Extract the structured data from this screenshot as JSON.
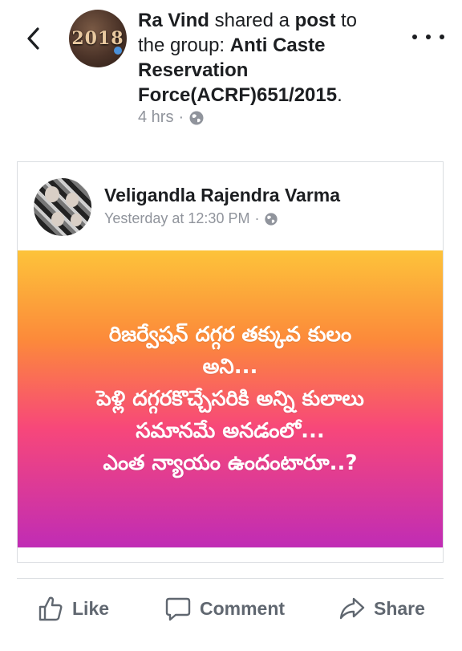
{
  "post": {
    "author": "Ra Vind",
    "shared_text": " shared a ",
    "post_word": "post",
    "to_text": " to the group: ",
    "group_name": "Anti Caste Reservation Force(ACRF)651/2015",
    "period": ".",
    "time": "4 hrs",
    "dot": "·",
    "avatar_text": "2018"
  },
  "shared": {
    "author": "Veligandla Rajendra Varma",
    "time": "Yesterday at 12:30 PM",
    "dot": "·",
    "lines": [
      "రిజర్వేషన్ దగ్గర తక్కువ కులం",
      "అని...",
      "పెళ్లి దగ్గరకొచ్చేసరికి అన్ని కులాలు",
      "సమానమే అనడంలో...",
      "ఎంత న్యాయం ఉందంటారూ..?"
    ]
  },
  "actions": {
    "like": "Like",
    "comment": "Comment",
    "share": "Share"
  },
  "colors": {
    "text": "#1c1e21",
    "meta": "#90949c",
    "action": "#606770",
    "gradient_top": "#fdc33a",
    "gradient_bottom": "#c02cb5"
  },
  "icons": {
    "back": "chevron-left-icon",
    "more": "more-horizontal-icon",
    "globe": "globe-icon",
    "like": "thumbs-up-icon",
    "comment": "comment-bubble-icon",
    "share": "share-arrow-icon"
  }
}
